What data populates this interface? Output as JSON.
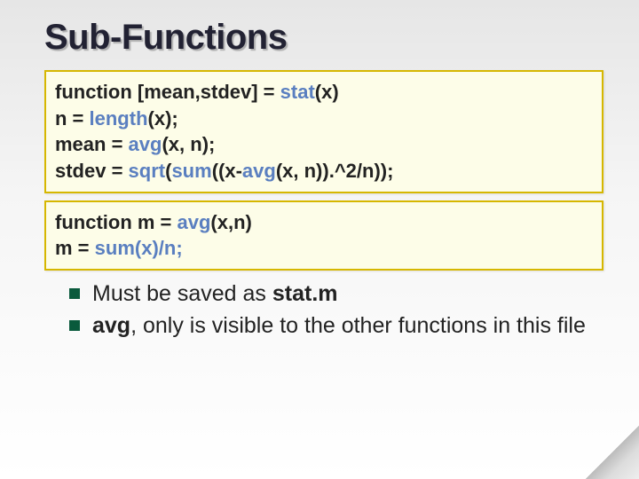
{
  "title": "Sub-Functions",
  "code1": {
    "l1a": "function [mean,stdev] = ",
    "l1b": "stat",
    "l1c": "(x)",
    "l2a": "n = ",
    "l2b": "length",
    "l2c": "(x);",
    "l3a": "mean = ",
    "l3b": "avg",
    "l3c": "(x, n);",
    "l4a": "stdev = ",
    "l4b": "sqrt",
    "l4c": "(",
    "l4d": "sum",
    "l4e": "((x-",
    "l4f": "avg",
    "l4g": "(x, n)).^2/n));"
  },
  "code2": {
    "l1a": "function m = ",
    "l1b": "avg",
    "l1c": "(x,n)",
    "l2a": "m = ",
    "l2b": "sum(x)/n;"
  },
  "bullets": {
    "b1a": "Must be saved as ",
    "b1b": "stat.m",
    "b2a": "avg",
    "b2b": ", only is visible to the other functions in this file"
  }
}
